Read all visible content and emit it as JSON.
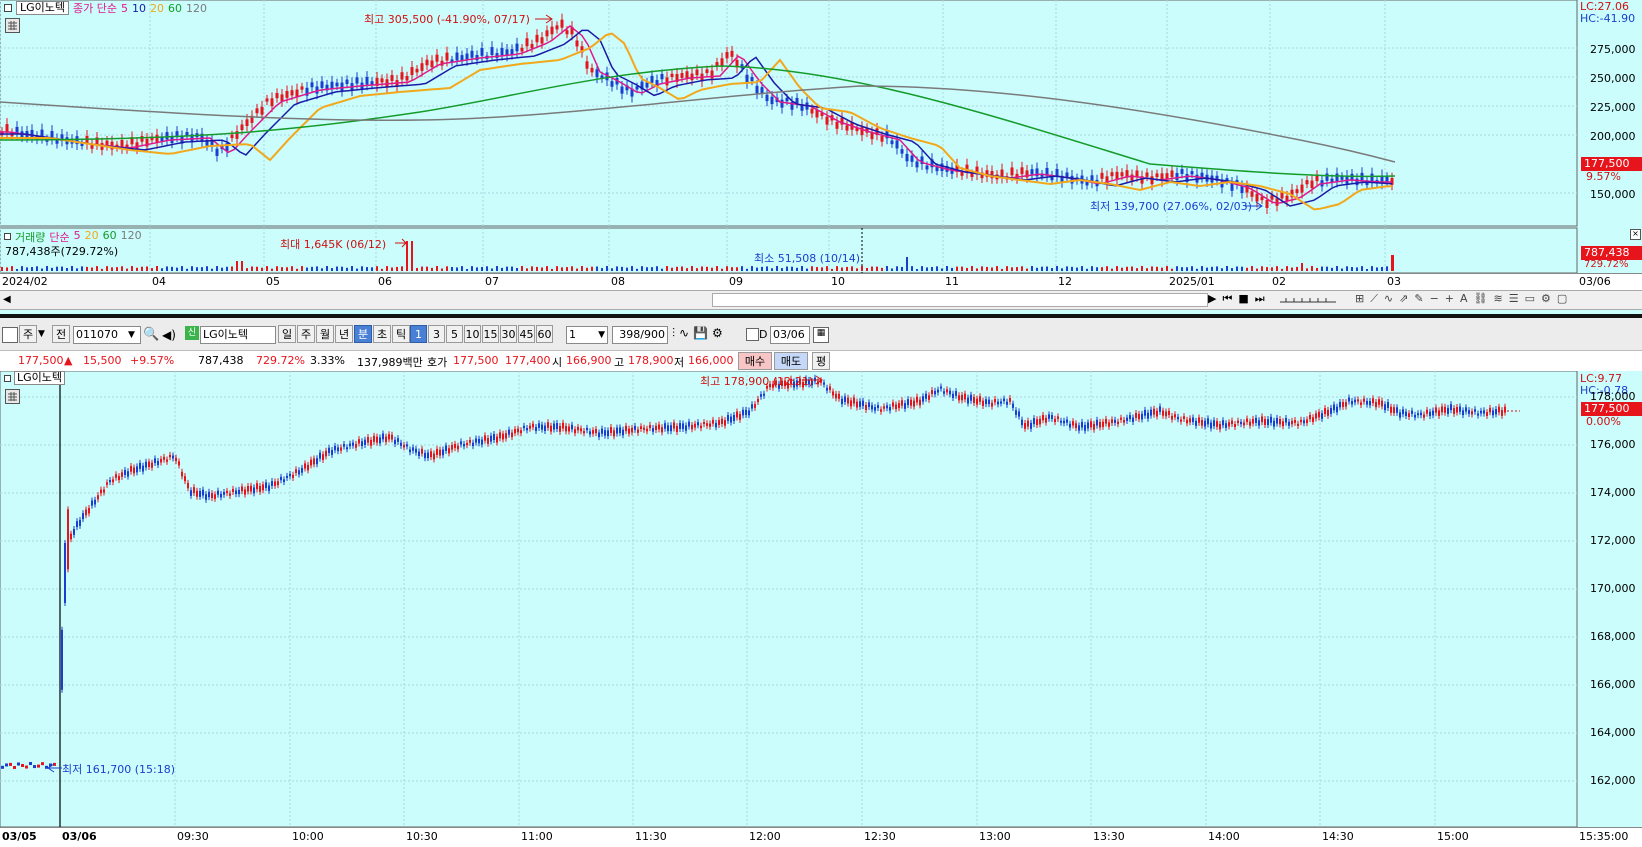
{
  "upper_chart": {
    "stock_name": "LG이노텍",
    "ma_label": "종가 단순",
    "ma_periods": [
      "5",
      "10",
      "20",
      "60",
      "120"
    ],
    "ma_colors": [
      "#e0198a",
      "#1a1aa8",
      "#f2a81a",
      "#149b2a",
      "#7a7a7a"
    ],
    "lc_label": "LC:27.06",
    "hc_label": "HC:-41.90",
    "high_annotation": "최고 305,500 (-41.90%, 07/17)",
    "low_annotation": "최저 139,700 (27.06%, 02/03)",
    "price_tag": "177,500",
    "pct_tag": "9.57%",
    "y_ticks": [
      "275,000",
      "250,000",
      "225,000",
      "200,000",
      "150,000"
    ],
    "volume": {
      "label": "거래량",
      "ma_label": "단순",
      "periods": [
        "5",
        "20",
        "60",
        "120"
      ],
      "value_label": "787,438주(729.72%)",
      "max_annotation": "최대 1,645K (06/12)",
      "min_annotation": "최소 51,508 (10/14)",
      "tag_value": "787,438",
      "tag_pct": "729.72%"
    },
    "x_ticks": [
      "2024/02",
      "04",
      "05",
      "06",
      "07",
      "08",
      "09",
      "10",
      "11",
      "12",
      "2025/01",
      "02",
      "03",
      "03/06"
    ]
  },
  "toolbar": {
    "period_a": "주",
    "period_b": "전",
    "code": "011070",
    "stock_name": "LG이노텍",
    "period_buttons": [
      "일",
      "주",
      "월",
      "년",
      "분",
      "초",
      "틱"
    ],
    "active_period": "분",
    "interval_buttons": [
      "1",
      "3",
      "5",
      "10",
      "15",
      "30",
      "45",
      "60"
    ],
    "active_interval": "1",
    "count_value": "1",
    "count_display": "398/900",
    "d_label": "D",
    "date_value": "03/06"
  },
  "quote_bar": {
    "price": "177,500",
    "change_arrow": "▲",
    "change": "15,500",
    "change_pct": "+9.57%",
    "volume": "787,438",
    "volume_pct": "729.72%",
    "turnover_pct": "3.33%",
    "amount": "137,989백만",
    "ask_label": "호가",
    "ask": "177,500",
    "bid": "177,400",
    "open_label": "시",
    "open": "166,900",
    "high_label": "고",
    "high": "178,900",
    "low_label": "저",
    "low": "166,000",
    "buy_label": "매수",
    "sell_label": "매도",
    "eval_label": "평"
  },
  "lower_chart": {
    "stock_name": "LG이노텍",
    "lc_label": "LC:9.77",
    "hc_label": "HC:-0.78",
    "high_annotation": "최고 178,900 (12:21)",
    "low_annotation": "최저 161,700 (15:18)",
    "price_tag": "177,500",
    "pct_tag": "0.00%",
    "y_ticks": [
      "178,000",
      "176,000",
      "174,000",
      "172,000",
      "170,000",
      "168,000",
      "166,000",
      "164,000",
      "162,000"
    ],
    "x_ticks": [
      "03/05",
      "03/06",
      "09:30",
      "10:00",
      "10:30",
      "11:00",
      "11:30",
      "12:00",
      "12:30",
      "13:00",
      "13:30",
      "14:00",
      "14:30",
      "15:00",
      "15:35:00"
    ],
    "colors": {
      "up": "#e8141c",
      "down": "#1a3fd0"
    }
  }
}
